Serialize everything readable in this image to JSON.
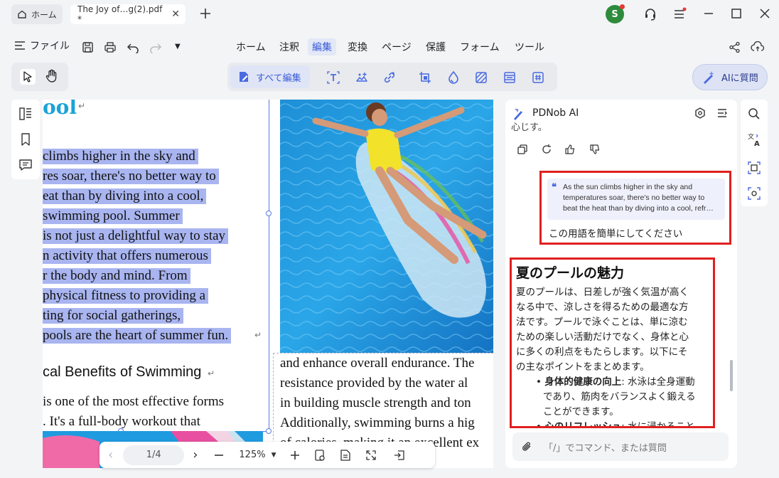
{
  "titlebar": {
    "home_tab": "ホーム",
    "doc_tab": "The Joy of…g(2).pdf *",
    "avatar_letter": "S"
  },
  "menu": {
    "file": "ファイル",
    "items": [
      "ホーム",
      "注釈",
      "編集",
      "変換",
      "ページ",
      "保護",
      "フォーム",
      "ツール"
    ],
    "active": "編集"
  },
  "toolbar": {
    "edit_all": "すべて編集",
    "ask_ai": "AIに質問"
  },
  "document": {
    "heading_fragment": "ool",
    "selected_lines": [
      "climbs higher in the sky and",
      "res soar, there's no better way to",
      "eat than by diving into a cool,",
      " swimming pool. Summer",
      " is not just a delightful way to stay",
      "n activity that offers numerous",
      "r the body and mind. From",
      " physical fitness to providing a",
      "ting for social gatherings,",
      " pools are the heart of summer fun."
    ],
    "section_title": "cal Benefits of Swimming",
    "left_body": [
      " is one of the most effective forms",
      ". It's a full-body workout that"
    ],
    "right_body": [
      "and enhance overall endurance. The",
      "resistance provided by the water al",
      "in building muscle strength and ton",
      "Additionally, swimming burns a hig",
      "of calories, making it an excellent ex"
    ]
  },
  "bottomnav": {
    "page": "1/4",
    "zoom": "125%"
  },
  "ai": {
    "title": "PDNob AI",
    "prev_fragment": "心じす。",
    "quote": "As the sun climbs higher in the sky and temperatures soar, there's no better way to beat the heat than by diving into a cool, refr…",
    "prompt": "この用語を簡単にしてください",
    "answer_title": "夏のプールの魅力",
    "answer_lines": [
      "夏のプールは、日差しが強く気温が高く",
      "なる中で、涼しさを得るための最適な方",
      "法です。プールで泳ぐことは、単に涼む",
      "ための楽しい活動だけでなく、身体と心",
      "に多くの利点をもたらします。以下にそ",
      "の主なポイントをまとめます。"
    ],
    "bullet1_bold": "身体的健康の向上",
    "bullet1_text": ": 水泳は全身運動",
    "bullet1_cont": [
      "であり、筋肉をバランスよく鍛える",
      "ことができます。"
    ],
    "bullet2_bold": "心のリフレッシュ",
    "bullet2_text": ": 水に浸かること",
    "input_placeholder": "「/」でコマンド、または質問"
  },
  "colors": {
    "accent": "#3a5bd9",
    "selection": "#a9b5f0",
    "highlight_box": "#e02020",
    "heading_blue": "#1aa3d8"
  }
}
